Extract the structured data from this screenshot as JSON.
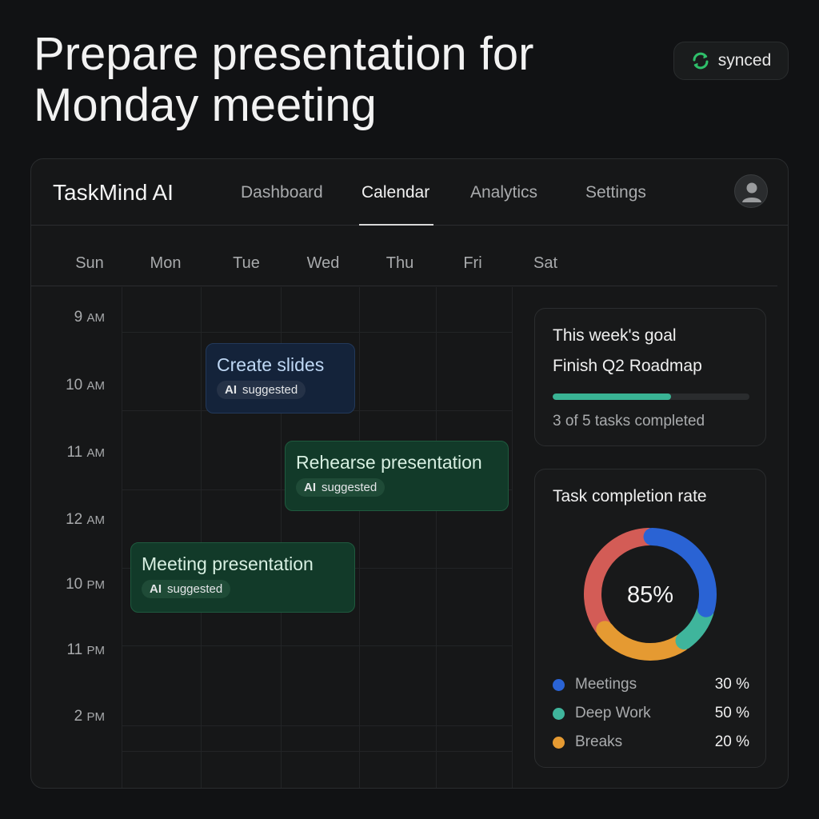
{
  "header": {
    "title": "Prepare presentation for Monday meeting",
    "sync_status": "synced"
  },
  "app": {
    "brand": "TaskMind AI",
    "nav": [
      {
        "label": "Dashboard",
        "active": false
      },
      {
        "label": "Calendar",
        "active": true
      },
      {
        "label": "Analytics",
        "active": false
      },
      {
        "label": "Settings",
        "active": false
      }
    ]
  },
  "calendar": {
    "weekdays": [
      "Sun",
      "Mon",
      "Tue",
      "Wed",
      "Thu",
      "Fri",
      "Sat"
    ],
    "times": [
      {
        "num": "9",
        "unit": "AM"
      },
      {
        "num": "10",
        "unit": "AM"
      },
      {
        "num": "11",
        "unit": "AM"
      },
      {
        "num": "12",
        "unit": "AM"
      },
      {
        "num": "10",
        "unit": "PM"
      },
      {
        "num": "11",
        "unit": "PM"
      },
      {
        "num": "2",
        "unit": "PM"
      }
    ],
    "events": [
      {
        "title": "Create slides",
        "tag": "AI",
        "tag_label": "suggested",
        "color": "blue"
      },
      {
        "title": "Rehearse presentation",
        "tag": "AI",
        "tag_label": "suggested",
        "color": "green"
      },
      {
        "title": "Meeting presentation",
        "tag": "AI",
        "tag_label": "suggested",
        "color": "green"
      }
    ]
  },
  "goal": {
    "title": "This week's goal",
    "name": "Finish Q2 Roadmap",
    "completed": 3,
    "total": 5,
    "status": "3 of 5 tasks completed",
    "progress_color": "#39b394"
  },
  "completion": {
    "title": "Task completion rate",
    "center_value": "85%",
    "legend": [
      {
        "label": "Meetings",
        "value": "30 %",
        "color": "#2a63d4"
      },
      {
        "label": "Deep Work",
        "value": "50 %",
        "color": "#3fb59c"
      },
      {
        "label": "Breaks",
        "value": "20 %",
        "color": "#e59a32"
      }
    ],
    "donut_segments": [
      {
        "share": 0.295,
        "color": "#2a63d4"
      },
      {
        "share": 0.11,
        "color": "#3fb59c"
      },
      {
        "share": 0.245,
        "color": "#e59a32"
      },
      {
        "share": 0.35,
        "color": "#d35c56"
      }
    ]
  }
}
